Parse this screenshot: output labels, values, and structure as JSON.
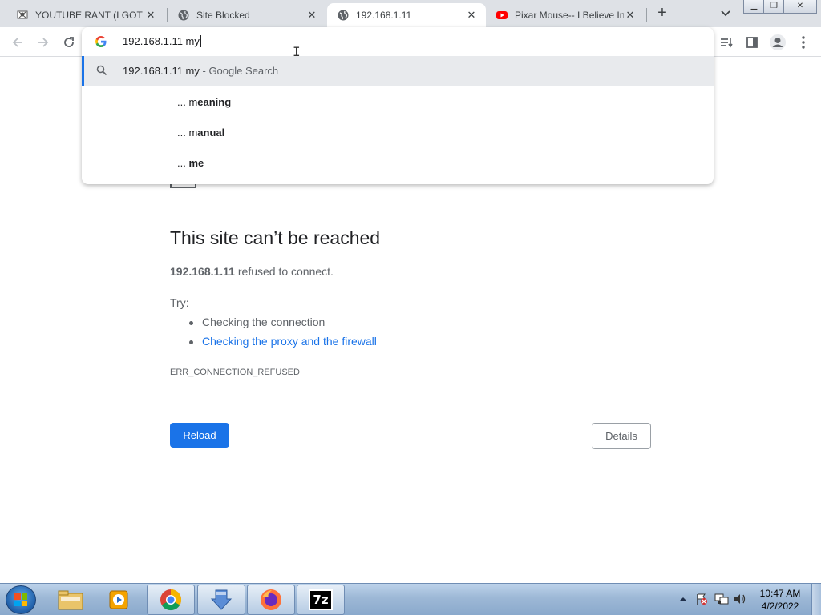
{
  "tabs": [
    {
      "title": "YOUTUBE RANT (I GOT B",
      "favicon": "pirate-flag-icon",
      "active": false
    },
    {
      "title": "Site Blocked",
      "favicon": "globe-icon",
      "active": false
    },
    {
      "title": "192.168.1.11",
      "favicon": "globe-icon",
      "active": true
    },
    {
      "title": "Pixar Mouse-- I Believe In",
      "favicon": "youtube-icon",
      "active": false
    }
  ],
  "new_tab_label": "+",
  "omnibox": {
    "text": "192.168.1.11 my",
    "suggestions": {
      "first": {
        "query": "192.168.1.11 my",
        "suffix": " - Google Search"
      },
      "items": [
        {
          "prefix": "... m",
          "bold": "eaning"
        },
        {
          "prefix": "... m",
          "bold": "anual"
        },
        {
          "prefix": "... ",
          "bold": "me"
        }
      ]
    }
  },
  "error": {
    "title": "This site can’t be reached",
    "host": "192.168.1.11",
    "desc_rest": " refused to connect.",
    "try_label": "Try:",
    "suggestions": [
      "Checking the connection",
      "Checking the proxy and the firewall"
    ],
    "code": "ERR_CONNECTION_REFUSED",
    "reload_label": "Reload",
    "details_label": "Details"
  },
  "taskbar": {
    "items": [
      "file-explorer-icon",
      "media-player-icon",
      "chrome-icon",
      "downloader-icon",
      "firefox-icon",
      "7zip-icon"
    ],
    "seven_zip_label": "7z",
    "clock_time": "10:47 AM",
    "clock_date": "4/2/2022"
  },
  "colors": {
    "accent": "#1a73e8",
    "tabstrip": "#dee1e6",
    "taskbar": "#9db8d6"
  }
}
